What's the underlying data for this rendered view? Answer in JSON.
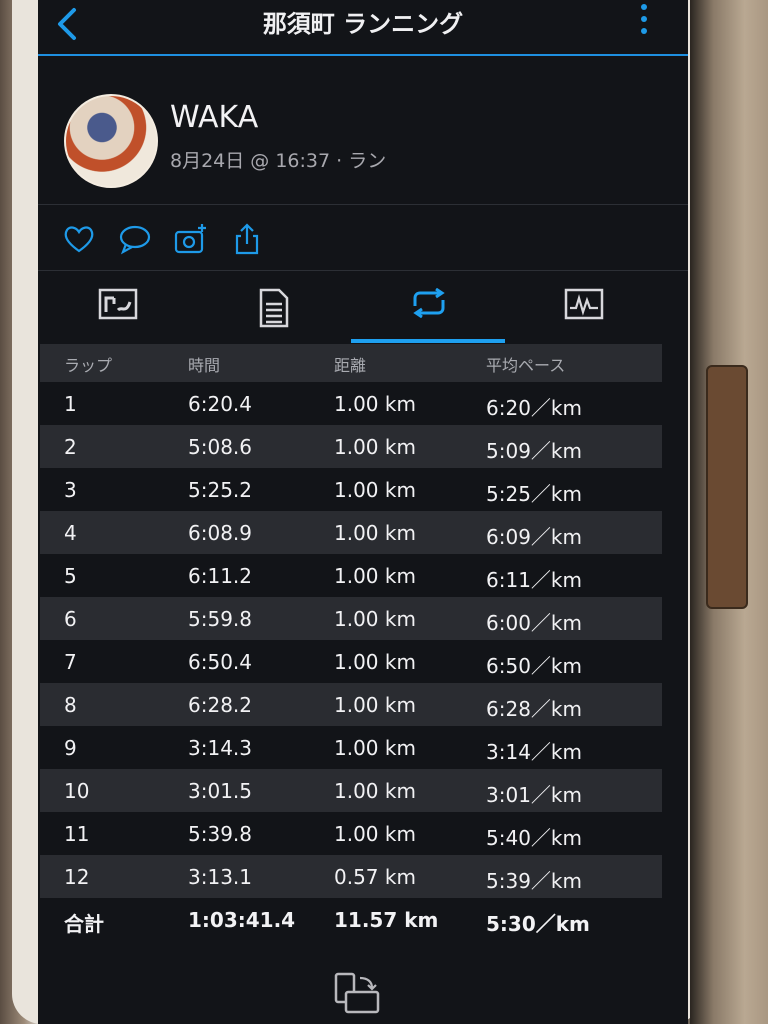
{
  "header": {
    "title": "那須町 ランニング"
  },
  "user": {
    "name": "WAKA",
    "subtitle": "8月24日 @ 16:37 · ラン"
  },
  "icons": {
    "back": "chevron-left-icon",
    "more": "more-vertical-icon",
    "like": "heart-icon",
    "comment": "comment-icon",
    "photo": "camera-plus-icon",
    "share": "share-icon",
    "tab_map": "map-tab-icon",
    "tab_summary": "summary-tab-icon",
    "tab_laps": "laps-tab-icon",
    "tab_chart": "chart-tab-icon",
    "rotate": "rotate-screen-icon"
  },
  "colors": {
    "accent": "#1ea0f0",
    "background": "#121418",
    "row_alt": "#2a2c31"
  },
  "chart_data": {
    "type": "table",
    "columns": [
      "ラップ",
      "時間",
      "距離",
      "平均ペース"
    ],
    "rows": [
      [
        "1",
        "6:20.4",
        "1.00 km",
        "6:20／km"
      ],
      [
        "2",
        "5:08.6",
        "1.00 km",
        "5:09／km"
      ],
      [
        "3",
        "5:25.2",
        "1.00 km",
        "5:25／km"
      ],
      [
        "4",
        "6:08.9",
        "1.00 km",
        "6:09／km"
      ],
      [
        "5",
        "6:11.2",
        "1.00 km",
        "6:11／km"
      ],
      [
        "6",
        "5:59.8",
        "1.00 km",
        "6:00／km"
      ],
      [
        "7",
        "6:50.4",
        "1.00 km",
        "6:50／km"
      ],
      [
        "8",
        "6:28.2",
        "1.00 km",
        "6:28／km"
      ],
      [
        "9",
        "3:14.3",
        "1.00 km",
        "3:14／km"
      ],
      [
        "10",
        "3:01.5",
        "1.00 km",
        "3:01／km"
      ],
      [
        "11",
        "5:39.8",
        "1.00 km",
        "5:40／km"
      ],
      [
        "12",
        "3:13.1",
        "0.57 km",
        "5:39／km"
      ]
    ],
    "total": [
      "合計",
      "1:03:41.4",
      "11.57 km",
      "5:30／km"
    ]
  }
}
